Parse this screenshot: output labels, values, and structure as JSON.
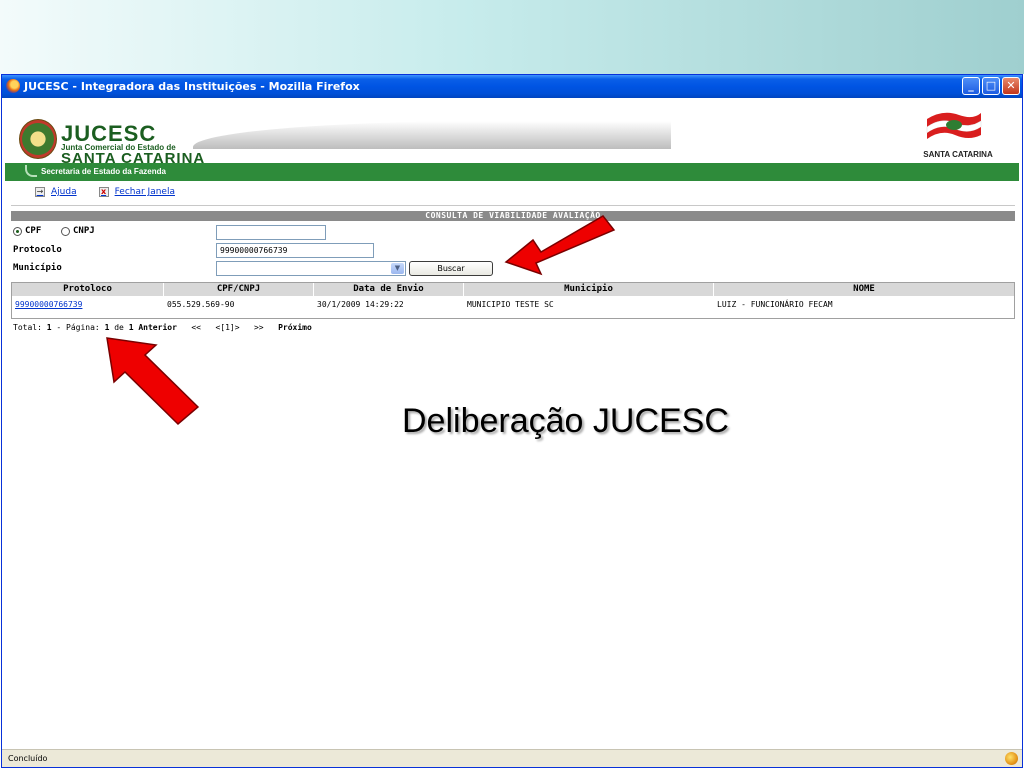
{
  "window": {
    "title": "JUCESC - Integradora das Instituições - Mozilla Firefox",
    "min_glyph": "_",
    "max_glyph": "□",
    "close_glyph": "✕"
  },
  "header": {
    "logo_title": "JUCESC",
    "logo_subtitle": "Junta Comercial do Estado de",
    "logo_state": "SANTA CATARINA",
    "right_logo_text": "SANTA CATARINA",
    "green_bar_text": "Secretaria de Estado da Fazenda"
  },
  "links": {
    "help": "Ajuda",
    "close_window": "Fechar Janela"
  },
  "section_title": "CONSULTA DE VIABILIDADE AVALIAÇÃO",
  "form": {
    "radio_cpf": "CPF",
    "radio_cnpj": "CNPJ",
    "selected_radio": "CPF",
    "cpf_value": "",
    "protocolo_label": "Protocolo",
    "protocolo_value": "99900000766739",
    "municipio_label": "Município",
    "municipio_value": "",
    "search_button": "Buscar"
  },
  "table": {
    "columns": [
      "Protoloco",
      "CPF/CNPJ",
      "Data de Envio",
      "Municipio",
      "NOME"
    ],
    "rows": [
      {
        "protocolo": "99900000766739",
        "cpf_cnpj": "055.529.569-90",
        "data_envio": "30/1/2009 14:29:22",
        "municipio": "MUNICIPIO TESTE SC",
        "nome": "LUIZ - FUNCIONÁRIO FECAM"
      }
    ]
  },
  "pager": {
    "total_label": "Total:",
    "total": "1",
    "page_label": "- Página:",
    "page": "1",
    "of_label": "de",
    "pages": "1",
    "prev": "Anterior",
    "first": "<<",
    "current": "<[1]>",
    "last": ">>",
    "next": "Próximo"
  },
  "status_bar": "Concluído",
  "caption": "Deliberação JUCESC",
  "colors": {
    "titlebar": "#0054e3",
    "green_bar": "#2e8b3a",
    "link": "#0033cc",
    "arrow": "#ee0000"
  }
}
